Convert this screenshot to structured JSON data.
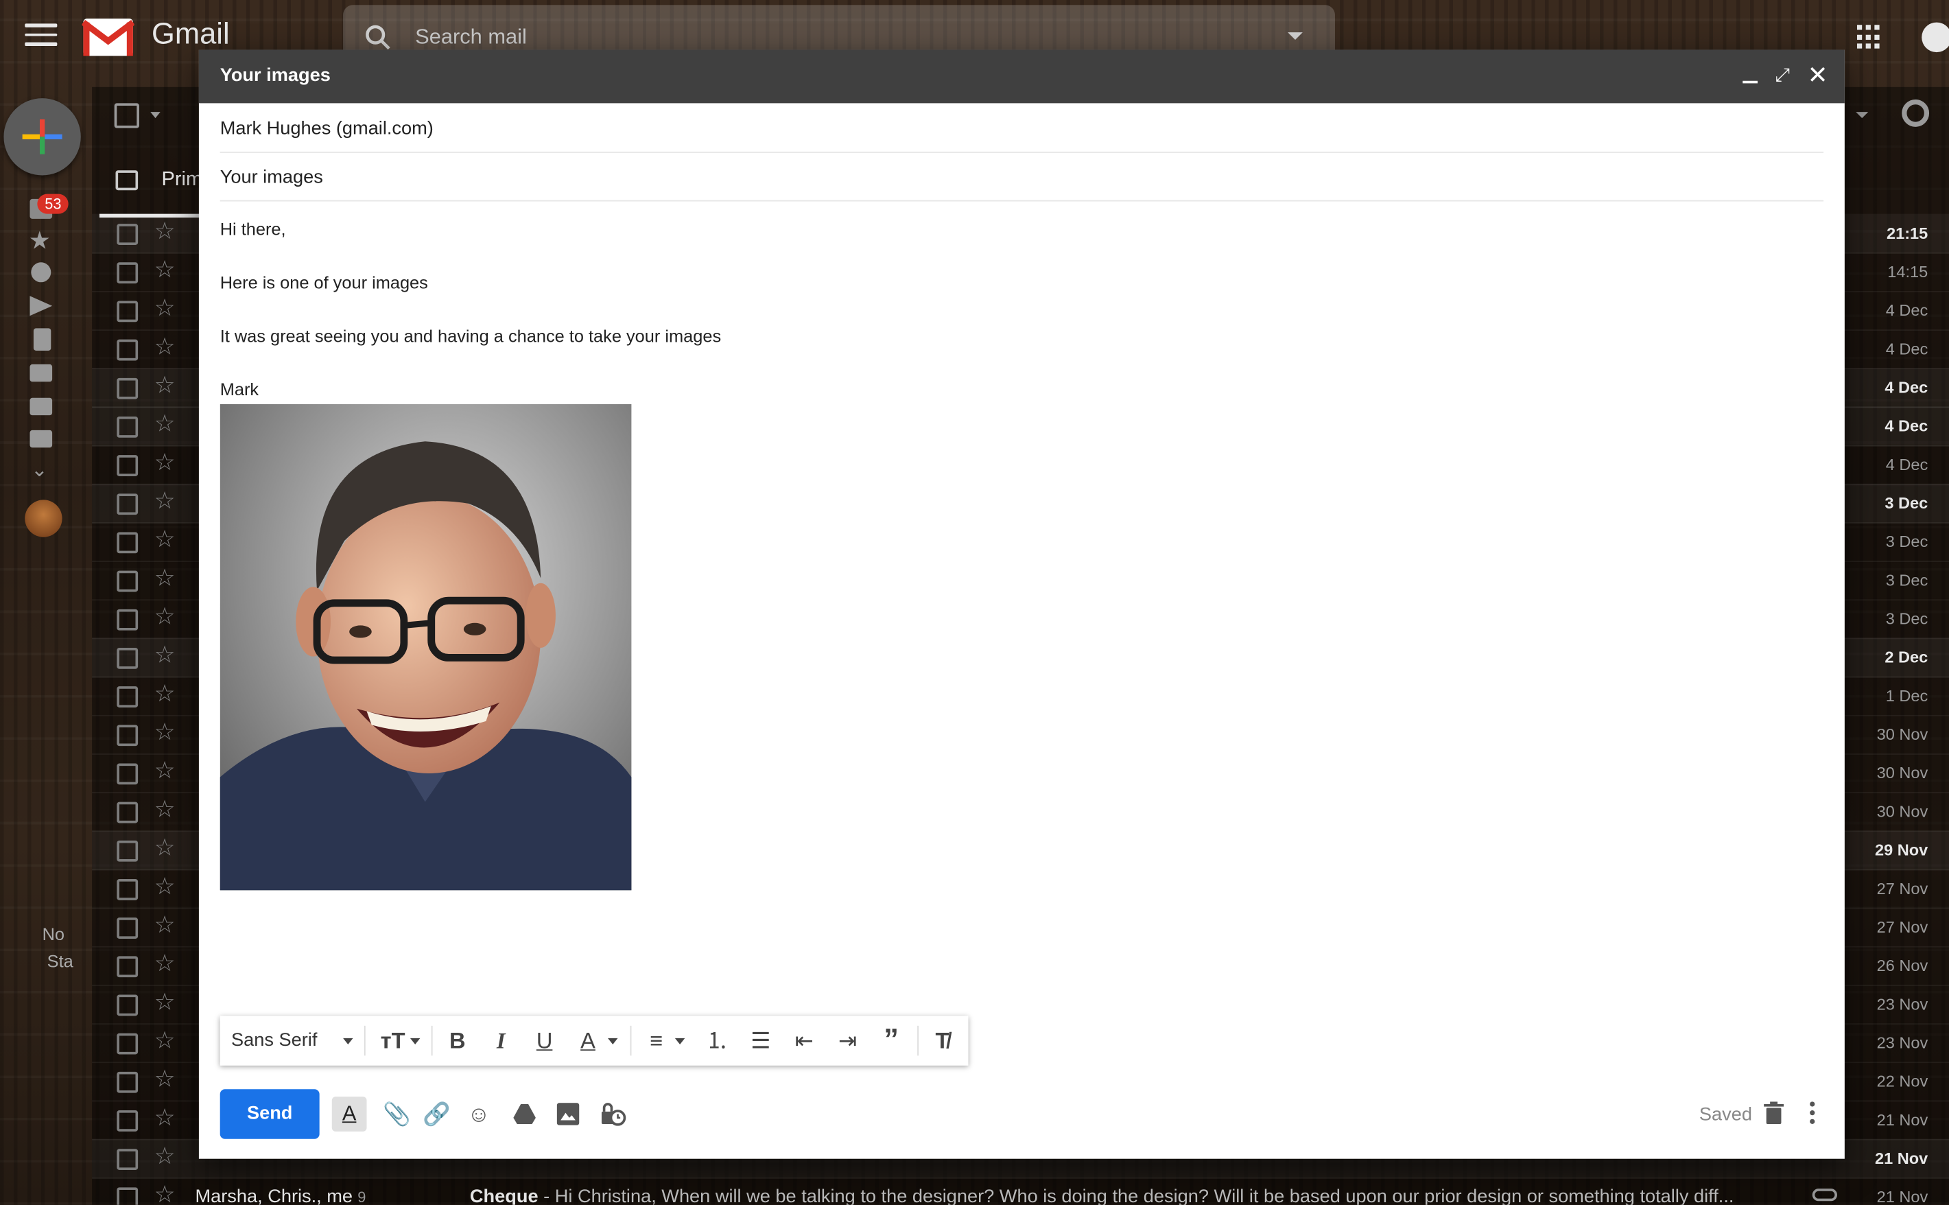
{
  "app": {
    "name": "Gmail"
  },
  "search": {
    "placeholder": "Search mail"
  },
  "nav": {
    "inbox_badge": "53",
    "no_started": "No",
    "no_started_2": "Sta"
  },
  "tabs": {
    "primary": "Prim"
  },
  "rows": [
    {
      "date": "21:15",
      "unread": true
    },
    {
      "date": "14:15",
      "unread": false
    },
    {
      "date": "4 Dec",
      "unread": false
    },
    {
      "date": "4 Dec",
      "unread": false
    },
    {
      "date": "4 Dec",
      "unread": true
    },
    {
      "date": "4 Dec",
      "unread": true
    },
    {
      "date": "4 Dec",
      "unread": false
    },
    {
      "date": "3 Dec",
      "unread": true
    },
    {
      "date": "3 Dec",
      "unread": false
    },
    {
      "date": "3 Dec",
      "unread": false
    },
    {
      "date": "3 Dec",
      "unread": false
    },
    {
      "date": "2 Dec",
      "unread": true
    },
    {
      "date": "1 Dec",
      "unread": false
    },
    {
      "date": "30 Nov",
      "unread": false
    },
    {
      "date": "30 Nov",
      "unread": false
    },
    {
      "date": "30 Nov",
      "unread": false
    },
    {
      "date": "29 Nov",
      "unread": true
    },
    {
      "date": "27 Nov",
      "unread": false
    },
    {
      "date": "27 Nov",
      "unread": false
    },
    {
      "date": "26 Nov",
      "unread": false
    },
    {
      "date": "23 Nov",
      "unread": false
    },
    {
      "date": "23 Nov",
      "unread": false
    },
    {
      "date": "22 Nov",
      "unread": false
    },
    {
      "date": "21 Nov",
      "unread": false
    },
    {
      "date": "21 Nov",
      "unread": true
    },
    {
      "date": "21 Nov",
      "unread": false,
      "sender": "Marsha, Chris., me",
      "count": "9",
      "subject": "Cheque",
      "snippet": " - Hi Christina, When will we be talking to the designer? Who is doing the design? Will it be based upon our prior design or something totally diff..."
    }
  ],
  "compose": {
    "title": "Your images",
    "to": "Mark Hughes (gmail.com)",
    "subject": "Your images",
    "body": {
      "greeting": "Hi there,",
      "line1": "Here is one of your images",
      "line2": "It was great seeing you and having a chance to take your images",
      "signoff": "Mark"
    },
    "font": "Sans Serif",
    "send_label": "Send",
    "status": "Saved"
  },
  "icons": [
    "menu-icon",
    "search-icon",
    "apps-icon",
    "account-icon",
    "gear-icon",
    "minimize-icon",
    "fullscreen-icon",
    "close-icon",
    "bold-icon",
    "italic-icon",
    "underline-icon",
    "text-color-icon",
    "align-icon",
    "numbered-list-icon",
    "bulleted-list-icon",
    "indent-less-icon",
    "indent-more-icon",
    "quote-icon",
    "remove-formatting-icon",
    "attach-icon",
    "link-icon",
    "emoji-icon",
    "drive-icon",
    "photo-icon",
    "confidential-icon",
    "trash-icon",
    "more-options-icon"
  ],
  "colors": {
    "send": "#1a73e8",
    "header": "#404040",
    "badge": "#d93025"
  }
}
